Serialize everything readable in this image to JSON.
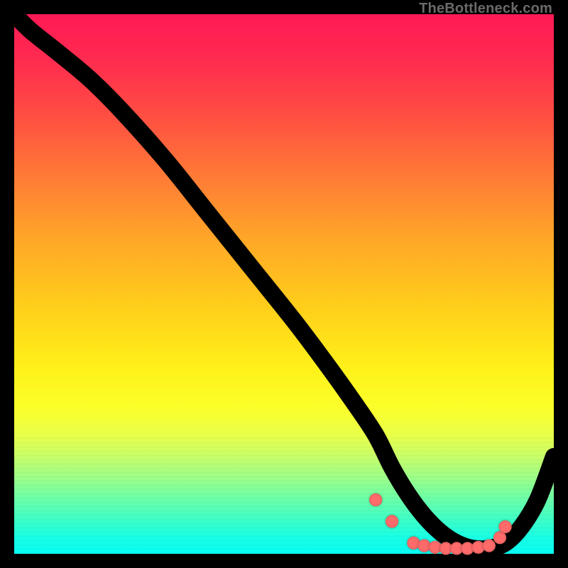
{
  "watermark": "TheBottleneck.com",
  "chart_data": {
    "type": "line",
    "title": "",
    "xlabel": "",
    "ylabel": "",
    "xlim": [
      0,
      100
    ],
    "ylim": [
      0,
      100
    ],
    "series": [
      {
        "name": "curve",
        "x": [
          0,
          3,
          8,
          14,
          20,
          28,
          36,
          44,
          52,
          58,
          63,
          67,
          70,
          73,
          76,
          79,
          82,
          85,
          88,
          91,
          94,
          97,
          100
        ],
        "y": [
          100,
          97,
          93,
          88,
          82,
          73,
          63,
          53,
          43,
          35,
          28,
          22,
          16,
          11,
          7,
          4,
          2,
          1,
          1,
          2,
          5,
          10,
          18
        ]
      }
    ],
    "markers": {
      "name": "highlight-dots",
      "x": [
        67,
        70,
        74,
        76,
        78,
        80,
        82,
        84,
        86,
        88,
        90,
        91
      ],
      "y": [
        10,
        6,
        2,
        1.5,
        1.2,
        1.0,
        1.0,
        1.0,
        1.2,
        1.5,
        3,
        5
      ]
    },
    "background": {
      "type": "vertical-gradient",
      "stops": [
        {
          "pos": 0.0,
          "color": "#ff1a55"
        },
        {
          "pos": 0.3,
          "color": "#ff7a36"
        },
        {
          "pos": 0.55,
          "color": "#ffd11a"
        },
        {
          "pos": 0.73,
          "color": "#fbff2a"
        },
        {
          "pos": 0.9,
          "color": "#6affaa"
        },
        {
          "pos": 1.0,
          "color": "#08fff6"
        }
      ]
    }
  }
}
